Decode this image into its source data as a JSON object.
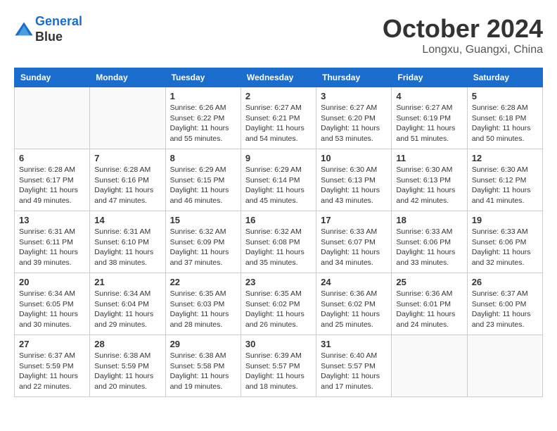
{
  "header": {
    "logo_line1": "General",
    "logo_line2": "Blue",
    "month": "October 2024",
    "location": "Longxu, Guangxi, China"
  },
  "weekdays": [
    "Sunday",
    "Monday",
    "Tuesday",
    "Wednesday",
    "Thursday",
    "Friday",
    "Saturday"
  ],
  "weeks": [
    [
      {
        "day": "",
        "info": ""
      },
      {
        "day": "",
        "info": ""
      },
      {
        "day": "1",
        "info": "Sunrise: 6:26 AM\nSunset: 6:22 PM\nDaylight: 11 hours and 55 minutes."
      },
      {
        "day": "2",
        "info": "Sunrise: 6:27 AM\nSunset: 6:21 PM\nDaylight: 11 hours and 54 minutes."
      },
      {
        "day": "3",
        "info": "Sunrise: 6:27 AM\nSunset: 6:20 PM\nDaylight: 11 hours and 53 minutes."
      },
      {
        "day": "4",
        "info": "Sunrise: 6:27 AM\nSunset: 6:19 PM\nDaylight: 11 hours and 51 minutes."
      },
      {
        "day": "5",
        "info": "Sunrise: 6:28 AM\nSunset: 6:18 PM\nDaylight: 11 hours and 50 minutes."
      }
    ],
    [
      {
        "day": "6",
        "info": "Sunrise: 6:28 AM\nSunset: 6:17 PM\nDaylight: 11 hours and 49 minutes."
      },
      {
        "day": "7",
        "info": "Sunrise: 6:28 AM\nSunset: 6:16 PM\nDaylight: 11 hours and 47 minutes."
      },
      {
        "day": "8",
        "info": "Sunrise: 6:29 AM\nSunset: 6:15 PM\nDaylight: 11 hours and 46 minutes."
      },
      {
        "day": "9",
        "info": "Sunrise: 6:29 AM\nSunset: 6:14 PM\nDaylight: 11 hours and 45 minutes."
      },
      {
        "day": "10",
        "info": "Sunrise: 6:30 AM\nSunset: 6:13 PM\nDaylight: 11 hours and 43 minutes."
      },
      {
        "day": "11",
        "info": "Sunrise: 6:30 AM\nSunset: 6:13 PM\nDaylight: 11 hours and 42 minutes."
      },
      {
        "day": "12",
        "info": "Sunrise: 6:30 AM\nSunset: 6:12 PM\nDaylight: 11 hours and 41 minutes."
      }
    ],
    [
      {
        "day": "13",
        "info": "Sunrise: 6:31 AM\nSunset: 6:11 PM\nDaylight: 11 hours and 39 minutes."
      },
      {
        "day": "14",
        "info": "Sunrise: 6:31 AM\nSunset: 6:10 PM\nDaylight: 11 hours and 38 minutes."
      },
      {
        "day": "15",
        "info": "Sunrise: 6:32 AM\nSunset: 6:09 PM\nDaylight: 11 hours and 37 minutes."
      },
      {
        "day": "16",
        "info": "Sunrise: 6:32 AM\nSunset: 6:08 PM\nDaylight: 11 hours and 35 minutes."
      },
      {
        "day": "17",
        "info": "Sunrise: 6:33 AM\nSunset: 6:07 PM\nDaylight: 11 hours and 34 minutes."
      },
      {
        "day": "18",
        "info": "Sunrise: 6:33 AM\nSunset: 6:06 PM\nDaylight: 11 hours and 33 minutes."
      },
      {
        "day": "19",
        "info": "Sunrise: 6:33 AM\nSunset: 6:06 PM\nDaylight: 11 hours and 32 minutes."
      }
    ],
    [
      {
        "day": "20",
        "info": "Sunrise: 6:34 AM\nSunset: 6:05 PM\nDaylight: 11 hours and 30 minutes."
      },
      {
        "day": "21",
        "info": "Sunrise: 6:34 AM\nSunset: 6:04 PM\nDaylight: 11 hours and 29 minutes."
      },
      {
        "day": "22",
        "info": "Sunrise: 6:35 AM\nSunset: 6:03 PM\nDaylight: 11 hours and 28 minutes."
      },
      {
        "day": "23",
        "info": "Sunrise: 6:35 AM\nSunset: 6:02 PM\nDaylight: 11 hours and 26 minutes."
      },
      {
        "day": "24",
        "info": "Sunrise: 6:36 AM\nSunset: 6:02 PM\nDaylight: 11 hours and 25 minutes."
      },
      {
        "day": "25",
        "info": "Sunrise: 6:36 AM\nSunset: 6:01 PM\nDaylight: 11 hours and 24 minutes."
      },
      {
        "day": "26",
        "info": "Sunrise: 6:37 AM\nSunset: 6:00 PM\nDaylight: 11 hours and 23 minutes."
      }
    ],
    [
      {
        "day": "27",
        "info": "Sunrise: 6:37 AM\nSunset: 5:59 PM\nDaylight: 11 hours and 22 minutes."
      },
      {
        "day": "28",
        "info": "Sunrise: 6:38 AM\nSunset: 5:59 PM\nDaylight: 11 hours and 20 minutes."
      },
      {
        "day": "29",
        "info": "Sunrise: 6:38 AM\nSunset: 5:58 PM\nDaylight: 11 hours and 19 minutes."
      },
      {
        "day": "30",
        "info": "Sunrise: 6:39 AM\nSunset: 5:57 PM\nDaylight: 11 hours and 18 minutes."
      },
      {
        "day": "31",
        "info": "Sunrise: 6:40 AM\nSunset: 5:57 PM\nDaylight: 11 hours and 17 minutes."
      },
      {
        "day": "",
        "info": ""
      },
      {
        "day": "",
        "info": ""
      }
    ]
  ]
}
